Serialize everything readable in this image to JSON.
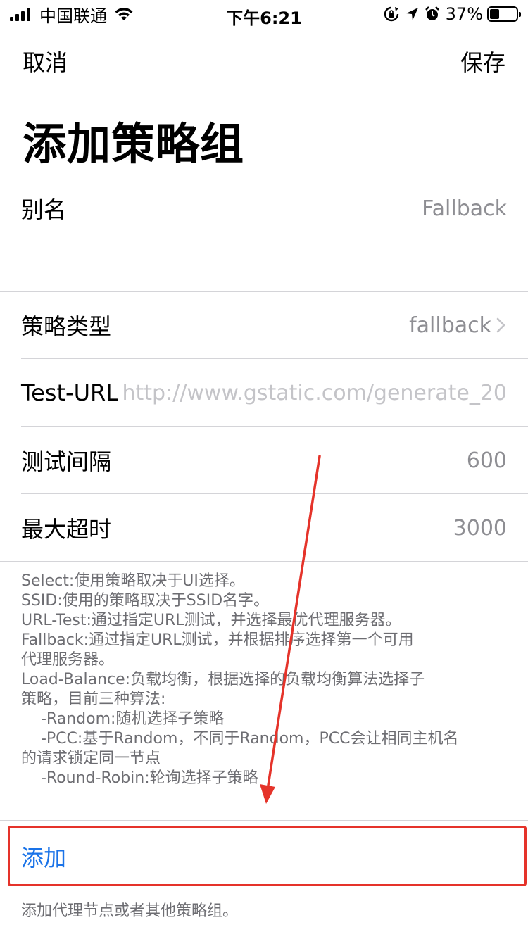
{
  "status_bar": {
    "carrier": "中国联通",
    "time": "下午6:21",
    "battery_percent": "37%",
    "battery_level": 0.37,
    "icons": [
      "signal-icon",
      "wifi-icon",
      "rotation-lock-icon",
      "location-icon",
      "alarm-icon",
      "battery-icon"
    ]
  },
  "nav": {
    "cancel_label": "取消",
    "save_label": "保存"
  },
  "title": "添加策略组",
  "alias": {
    "label": "别名",
    "placeholder": "Fallback"
  },
  "settings": {
    "policy_type": {
      "label": "策略类型",
      "value": "fallback"
    },
    "test_url": {
      "label": "Test-URL",
      "placeholder": "http://www.gstatic.com/generate_20"
    },
    "test_interval": {
      "label": "测试间隔",
      "placeholder": "600"
    },
    "max_timeout": {
      "label": "最大超时",
      "placeholder": "3000"
    }
  },
  "description": {
    "lines": [
      "Select:使用策略取决于UI选择。",
      "SSID:使用的策略取决于SSID名字。",
      "URL-Test:通过指定URL测试，并选择最优代理服务器。",
      "Fallback:通过指定URL测试，并根据排序选择第一个可用",
      "代理服务器。",
      "Load-Balance:负载均衡，根据选择的负载均衡算法选择子",
      "策略，目前三种算法:",
      "    -Random:随机选择子策略",
      "    -PCC:基于Random，不同于Random，PCC会让相同主机名",
      "的请求锁定同一节点",
      "    -Round-Robin:轮询选择子策略"
    ]
  },
  "add": {
    "label": "添加",
    "footer": "添加代理节点或者其他策略组。"
  },
  "colors": {
    "accent": "#1a73e8",
    "annotation": "#e5332a",
    "secondary_text": "#8e8e93",
    "separator": "#d4d4d8"
  }
}
